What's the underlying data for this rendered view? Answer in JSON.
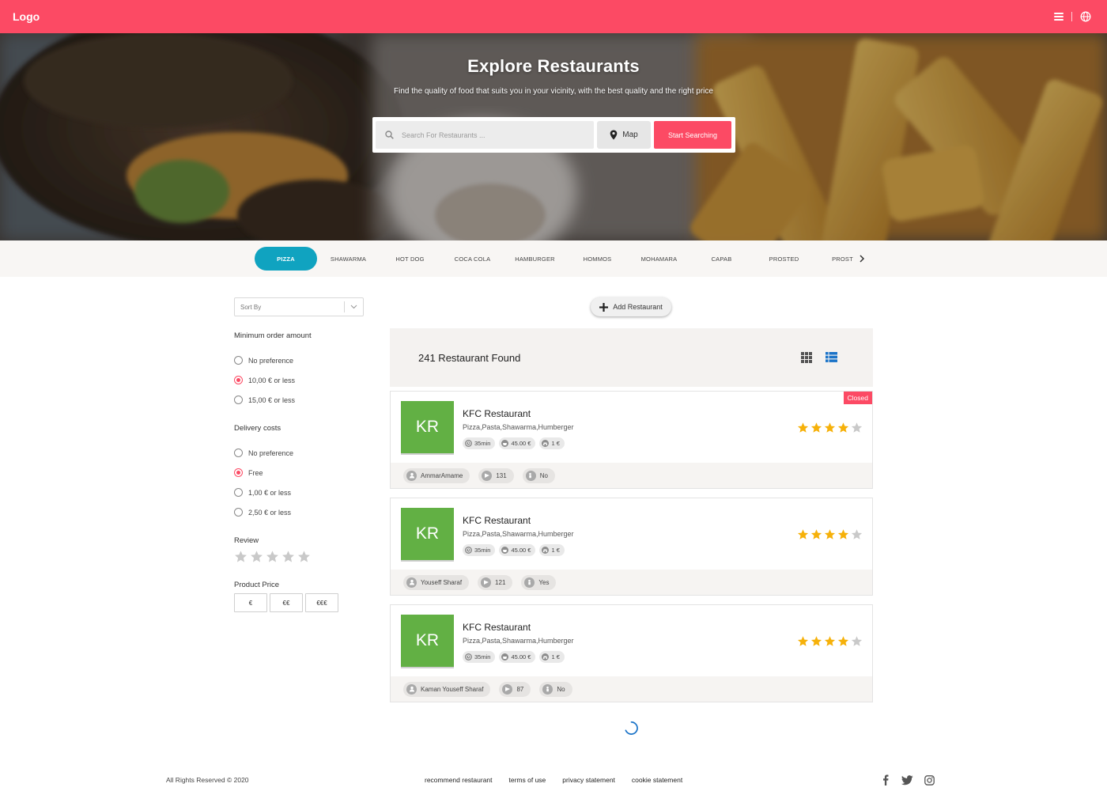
{
  "topbar": {
    "logo": "Logo",
    "menu_icon": "hamburger-menu-icon",
    "language_icon": "globe-icon",
    "color": "#fc4a64"
  },
  "hero": {
    "title": "Explore Restaurants",
    "subtitle": "Find the quality of food that suits you in your vicinity, with the best quality and the right price",
    "search_placeholder": "Search For Restaurants ...",
    "map_label": "Map",
    "start_label": "Start Searching"
  },
  "categories": [
    {
      "label": "PIZZA",
      "active": true
    },
    {
      "label": "SHAWARMA"
    },
    {
      "label": "HOT DOG"
    },
    {
      "label": "COCA COLA"
    },
    {
      "label": "HAMBURGER"
    },
    {
      "label": "HOMMOS"
    },
    {
      "label": "MOHAMARA"
    },
    {
      "label": "CAPAB"
    },
    {
      "label": "PROSTED"
    },
    {
      "label": "PROST"
    }
  ],
  "filters": {
    "sort_label": "Sort By",
    "min_order": {
      "title": "Minimum order amount",
      "options": [
        {
          "label": "No preference",
          "selected": false
        },
        {
          "label": "10,00 € or less",
          "selected": true
        },
        {
          "label": "15,00 € or less",
          "selected": false
        }
      ]
    },
    "delivery": {
      "title": "Delivery costs",
      "options": [
        {
          "label": "No preference",
          "selected": false
        },
        {
          "label": "Free",
          "selected": true
        },
        {
          "label": "1,00 € or less",
          "selected": false
        },
        {
          "label": "2,50 € or less",
          "selected": false
        }
      ]
    },
    "review": {
      "title": "Review",
      "stars": 5,
      "rating": 0
    },
    "price": {
      "title": "Product Price",
      "options": [
        "€",
        "€€",
        "€€€"
      ]
    }
  },
  "main": {
    "add_label": "Add Restaurant",
    "found_text": "241 Restaurant Found",
    "accent": "#1a73c8"
  },
  "restaurants": [
    {
      "initials": "KR",
      "name": "KFC Restaurant",
      "cuisine": "Pizza,Pasta,Shawarma,Humberger",
      "time": "35min",
      "min_order": "45.00 €",
      "delivery": "1 €",
      "user": "AmmarAmame",
      "reviews": "131",
      "flag": "No",
      "rating": 4,
      "badge": "Closed"
    },
    {
      "initials": "KR",
      "name": "KFC Restaurant",
      "cuisine": "Pizza,Pasta,Shawarma,Humberger",
      "time": "35min",
      "min_order": "45.00 €",
      "delivery": "1 €",
      "user": "Youseff Sharaf",
      "reviews": "121",
      "flag": "Yes",
      "rating": 4,
      "badge": ""
    },
    {
      "initials": "KR",
      "name": "KFC Restaurant",
      "cuisine": "Pizza,Pasta,Shawarma,Humberger",
      "time": "35min",
      "min_order": "45.00 €",
      "delivery": "1 €",
      "user": "Kaman Youseff Sharaf",
      "reviews": "87",
      "flag": "No",
      "rating": 4,
      "badge": ""
    }
  ],
  "footer": {
    "copyright": "All Rights Reserved © 2020",
    "links": [
      "recommend restaurant",
      "terms of use",
      "privacy statement",
      "cookie statement"
    ],
    "social": [
      "facebook-icon",
      "twitter-icon",
      "instagram-icon"
    ]
  }
}
